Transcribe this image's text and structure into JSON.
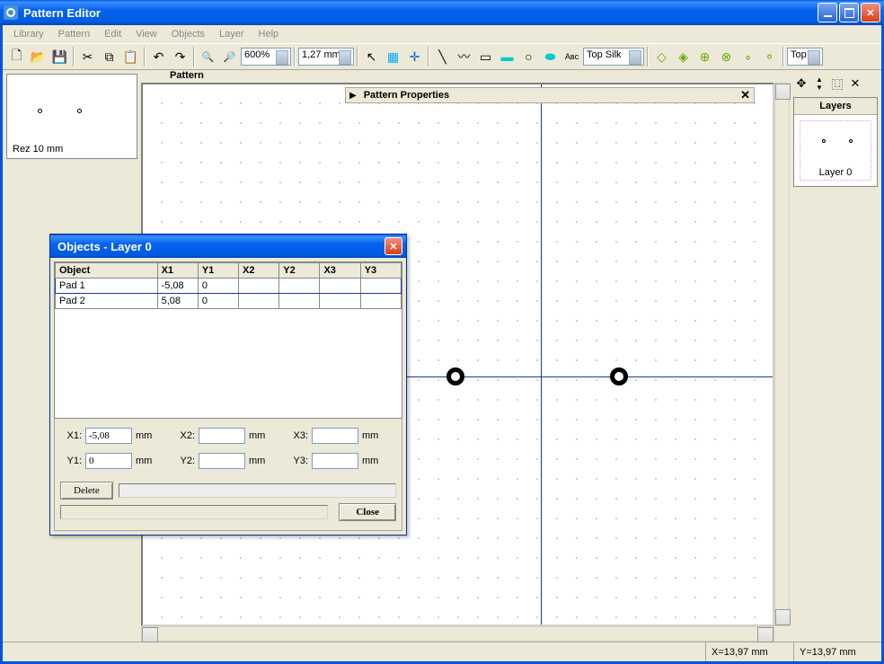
{
  "window": {
    "title": "Pattern Editor"
  },
  "menu": {
    "library": "Library",
    "pattern": "Pattern",
    "edit": "Edit",
    "view": "View",
    "objects": "Objects",
    "layer": "Layer",
    "help": "Help"
  },
  "toolbar": {
    "zoom": "600%",
    "grid": "1,27 mm",
    "layer_combo": "Top Silk",
    "layer_combo2": "Top"
  },
  "preview": {
    "label": "Rez 10 mm"
  },
  "canvas": {
    "title": "Pattern"
  },
  "pattern_props": {
    "title": "Pattern Properties"
  },
  "layers": {
    "title": "Layers",
    "item0": "Layer 0"
  },
  "status": {
    "x": "X=13,97 mm",
    "y": "Y=13,97 mm"
  },
  "dialog": {
    "title": "Objects - Layer 0",
    "headers": {
      "object": "Object",
      "x1": "X1",
      "y1": "Y1",
      "x2": "X2",
      "y2": "Y2",
      "x3": "X3",
      "y3": "Y3"
    },
    "rows": [
      {
        "object": "Pad 1",
        "x1": "-5,08",
        "y1": "0",
        "x2": "",
        "y2": "",
        "x3": "",
        "y3": ""
      },
      {
        "object": "Pad 2",
        "x1": "5,08",
        "y1": "0",
        "x2": "",
        "y2": "",
        "x3": "",
        "y3": ""
      }
    ],
    "labels": {
      "x1": "X1:",
      "y1": "Y1:",
      "x2": "X2:",
      "y2": "Y2:",
      "x3": "X3:",
      "y3": "Y3:",
      "mm": "mm"
    },
    "inputs": {
      "x1": "-5,08",
      "y1": "0",
      "x2": "",
      "y2": "",
      "x3": "",
      "y3": ""
    },
    "buttons": {
      "delete": "Delete",
      "close": "Close"
    }
  }
}
